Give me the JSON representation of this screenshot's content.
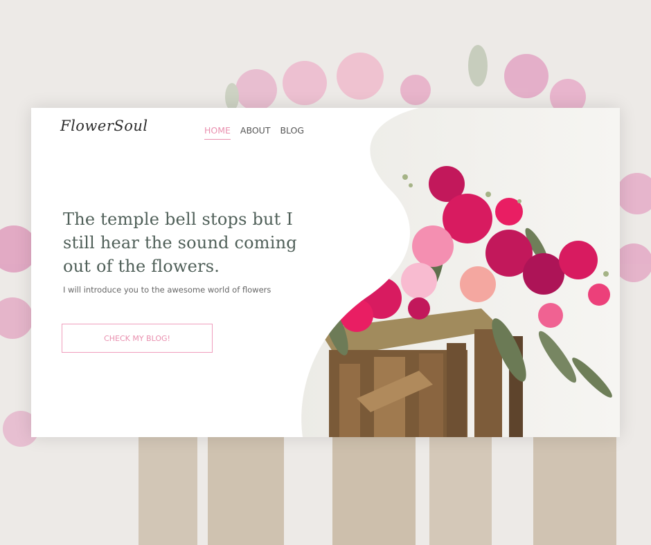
{
  "logo": {
    "text": "FlowerSoul"
  },
  "nav": {
    "items": [
      {
        "label": "HOME",
        "active": true
      },
      {
        "label": "ABOUT",
        "active": false
      },
      {
        "label": "BLOG",
        "active": false
      }
    ]
  },
  "hero": {
    "title": "The temple bell stops but I still hear the sound coming out of the flowers.",
    "subtitle": "I will introduce you to the awesome world of flowers",
    "cta_label": "CHECK MY BLOG!"
  },
  "colors": {
    "accent": "#e98fae",
    "title": "#4f5f58",
    "card_bg": "#ffffff",
    "backdrop": "#ece9e6"
  }
}
